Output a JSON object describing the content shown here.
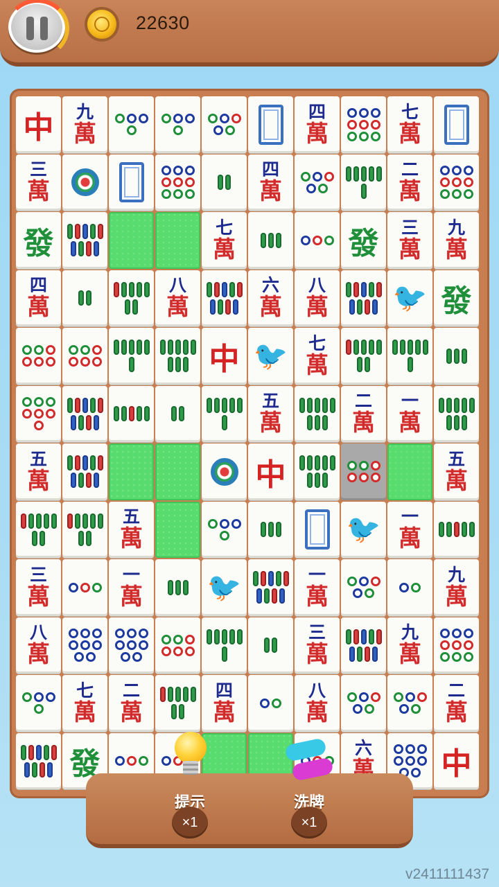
{
  "topbar": {
    "coins": "22630"
  },
  "tools": {
    "hint": {
      "label": "提示",
      "count": "×1"
    },
    "shuffle": {
      "label": "洗牌",
      "count": "×1"
    }
  },
  "version": "v2411111437",
  "colors": {
    "board": "#c97e52",
    "empty_cell": "#58dc6e",
    "wan_red": "#d22b2b",
    "wan_blue": "#1d2b8f"
  },
  "board": {
    "rows": [
      [
        "red_dragon",
        "wan:九",
        "dots4",
        "dots4",
        "dots5",
        "white_dragon",
        "wan:四",
        "dots9",
        "wan:七",
        "white_dragon"
      ],
      [
        "wan:三",
        "dots1",
        "white_dragon",
        "dots9",
        "bam2",
        "wan:四",
        "dots5",
        "bam6",
        "wan:二",
        "dots9"
      ],
      [
        "green_dragon",
        "bam9",
        "empty",
        "empty",
        "wan:七",
        "bam3",
        "dots3",
        "green_dragon",
        "wan:三",
        "wan:九"
      ],
      [
        "wan:四",
        "bam2",
        "bam7",
        "wan:八",
        "bam9",
        "wan:六",
        "wan:八",
        "bam9",
        "bird",
        "green_dragon"
      ],
      [
        "dots6",
        "dots6",
        "bam6",
        "bam8",
        "red_dragon",
        "bird",
        "wan:七",
        "bam7",
        "bam6",
        "bam3"
      ],
      [
        "dots7",
        "bam9",
        "bam5",
        "bam2",
        "bam6",
        "wan:五",
        "bam8",
        "wan:二",
        "wan:一",
        "bam8"
      ],
      [
        "wan:五",
        "bam9",
        "empty",
        "empty",
        "dots1",
        "red_dragon",
        "bam8",
        "selected:dots6",
        "empty",
        "wan:五"
      ],
      [
        "bam7",
        "bam7",
        "wan:五",
        "empty",
        "dots4",
        "bam3",
        "white_dragon",
        "bird",
        "wan:一",
        "bam5"
      ],
      [
        "wan:三",
        "dots3",
        "wan:一",
        "bam3",
        "bird",
        "bam9",
        "wan:一",
        "dots5",
        "dots2",
        "wan:九"
      ],
      [
        "wan:八",
        "dots8",
        "dots8",
        "dots6",
        "bam6",
        "bam2",
        "wan:三",
        "bam9",
        "wan:九",
        "dots9"
      ],
      [
        "dots4",
        "wan:七",
        "wan:二",
        "bam7",
        "wan:四",
        "dots2",
        "wan:八",
        "dots5",
        "dots5",
        "wan:二"
      ],
      [
        "bam9",
        "green_dragon",
        "dots3",
        "dots3",
        "empty",
        "empty",
        "dots3",
        "wan:六",
        "dots8",
        "red_dragon"
      ]
    ],
    "wan_char": "萬",
    "red_dragon_char": "中",
    "green_dragon_char": "發"
  }
}
